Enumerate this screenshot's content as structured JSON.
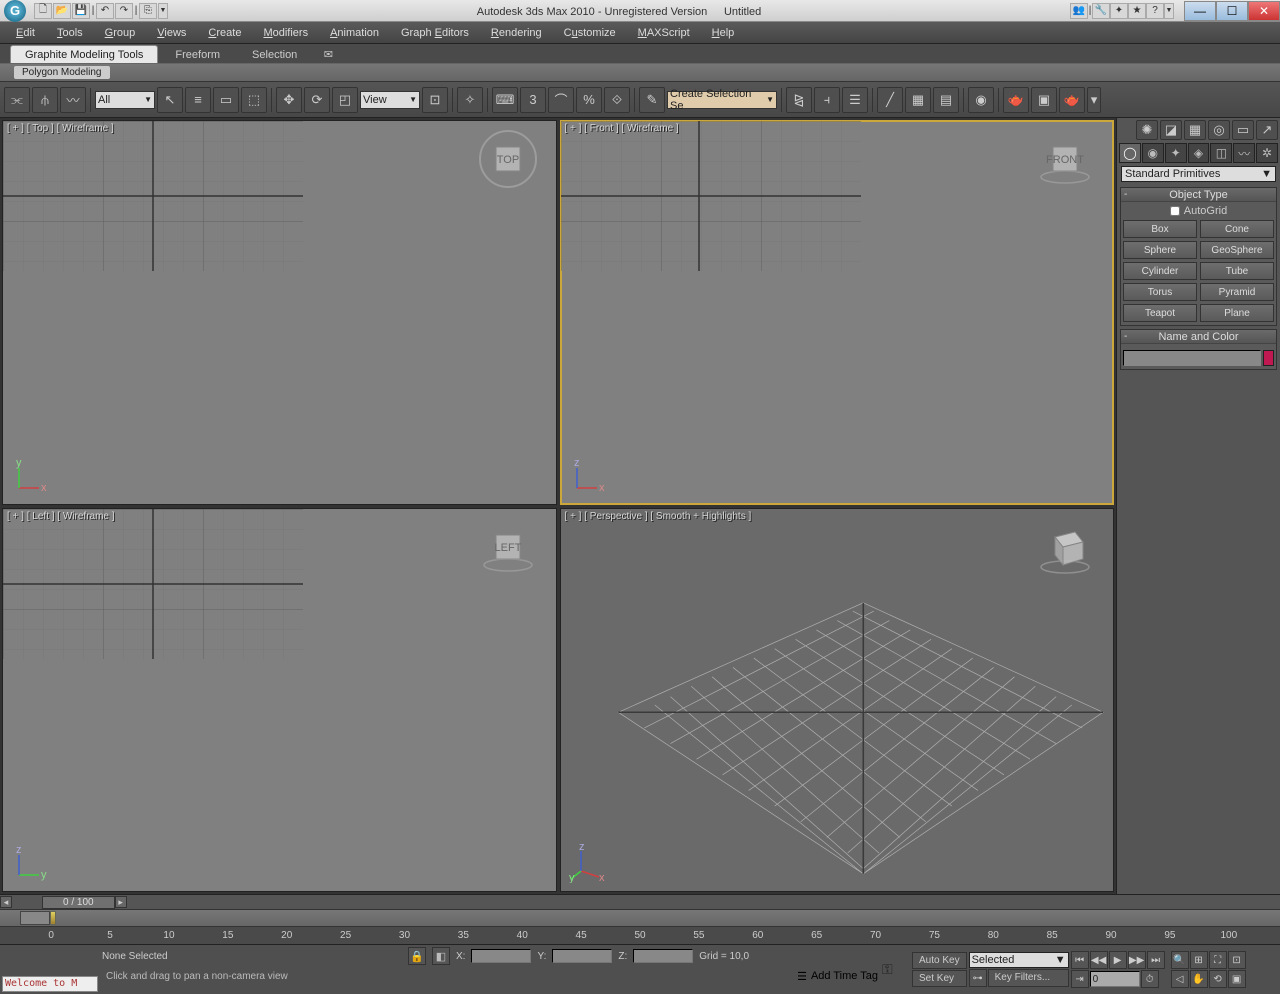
{
  "titlebar": {
    "app_title": "Autodesk 3ds Max 2010  - Unregistered Version",
    "doc_title": "Untitled"
  },
  "menu": {
    "items": [
      "Edit",
      "Tools",
      "Group",
      "Views",
      "Create",
      "Modifiers",
      "Animation",
      "Graph Editors",
      "Rendering",
      "Customize",
      "MAXScript",
      "Help"
    ]
  },
  "ribbon": {
    "tabs": [
      "Graphite Modeling Tools",
      "Freeform",
      "Selection"
    ],
    "sub": "Polygon Modeling"
  },
  "toolbar": {
    "combo_all": "All",
    "combo_view": "View",
    "named_sel": "Create Selection Se"
  },
  "viewports": {
    "top": "[ + ] [ Top ] [ Wireframe ]",
    "front": "[ + ] [ Front ] [ Wireframe ]",
    "left": "[ + ] [ Left ] [ Wireframe ]",
    "persp": "[ + ] [ Perspective ] [ Smooth + Highlights ]"
  },
  "command_panel": {
    "combo": "Standard Primitives",
    "rollout1_title": "Object Type",
    "autogrid": "AutoGrid",
    "objects": [
      "Box",
      "Cone",
      "Sphere",
      "GeoSphere",
      "Cylinder",
      "Tube",
      "Torus",
      "Pyramid",
      "Teapot",
      "Plane"
    ],
    "rollout2_title": "Name and Color"
  },
  "timeline": {
    "frame_indicator": "0 / 100",
    "ticks": [
      0,
      5,
      10,
      15,
      20,
      25,
      30,
      35,
      40,
      45,
      50,
      55,
      60,
      65,
      70,
      75,
      80,
      85,
      90,
      95,
      100
    ]
  },
  "status": {
    "welcome": "Welcome to M",
    "none_selected": "None Selected",
    "prompt": "Click and drag to pan a non-camera view",
    "x": "X:",
    "y": "Y:",
    "z": "Z:",
    "grid": "Grid = 10,0",
    "add_time_tag": "Add Time Tag",
    "auto_key": "Auto Key",
    "set_key": "Set Key",
    "selected": "Selected",
    "key_filters": "Key Filters...",
    "frame_field": "0"
  }
}
